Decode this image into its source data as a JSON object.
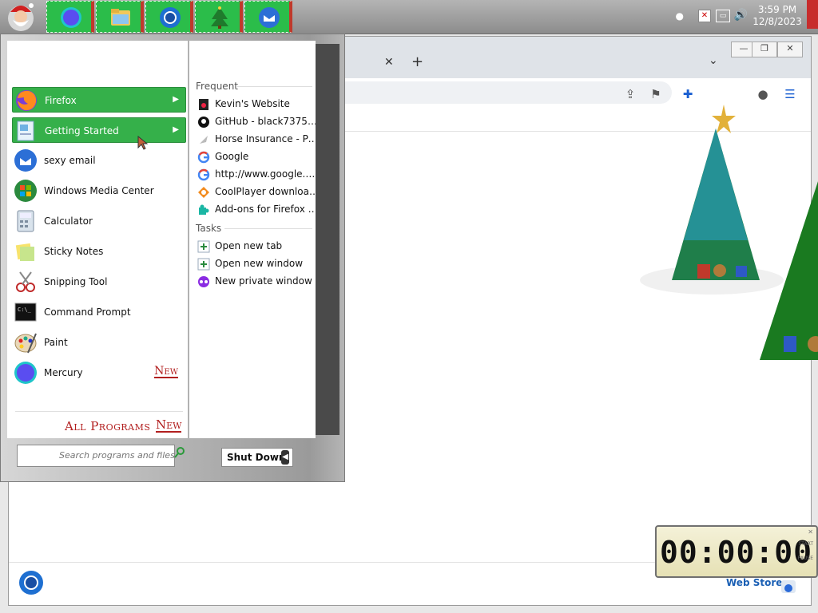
{
  "taskbar": {
    "start_button": "start-orb",
    "pinned": [
      {
        "name": "mercury-browser",
        "icon": "mercury-icon"
      },
      {
        "name": "file-explorer",
        "icon": "folder-icon"
      },
      {
        "name": "chrome-browser",
        "icon": "browser-icon"
      },
      {
        "name": "christmas-tree-app",
        "icon": "tree-icon"
      },
      {
        "name": "thunderbird-mail",
        "icon": "mail-icon"
      }
    ],
    "clock": {
      "time": "3:59 PM",
      "date": "12/8/2023"
    }
  },
  "browser": {
    "tab_close_glyph": "✕",
    "new_tab_glyph": "+",
    "bottom_link": "Web Store"
  },
  "start_menu": {
    "programs": [
      {
        "label": "Firefox",
        "highlighted": true,
        "has_submenu": true
      },
      {
        "label": "Getting Started",
        "highlighted": true,
        "has_submenu": true
      },
      {
        "label": "sexy email"
      },
      {
        "label": "Windows Media Center"
      },
      {
        "label": "Calculator"
      },
      {
        "label": "Sticky Notes"
      },
      {
        "label": "Snipping Tool"
      },
      {
        "label": "Command Prompt"
      },
      {
        "label": "Paint"
      },
      {
        "label": "Mercury",
        "badge": "New"
      }
    ],
    "all_programs_label": "All Programs",
    "all_programs_badge": "New",
    "search_placeholder": "Search programs and files",
    "shutdown_label": "Shut Down",
    "jumplist": {
      "frequent_header": "Frequent",
      "frequent": [
        "Kevin's Website",
        "GitHub - black7375/Fir...",
        "Horse Insurance - Pick ...",
        "Google",
        "http://www.google.co...",
        "CoolPlayer download | ...",
        "Add-ons for Firefox (en..."
      ],
      "tasks_header": "Tasks",
      "tasks": [
        "Open new tab",
        "Open new window",
        "New private window"
      ]
    }
  },
  "timer_widget": {
    "display": "00:00:00",
    "controls": [
      "START",
      "PAUSE"
    ]
  },
  "colors": {
    "highlight_green": "#35b04a",
    "new_badge_red": "#b21f1f",
    "link_blue": "#1a5fb4"
  }
}
